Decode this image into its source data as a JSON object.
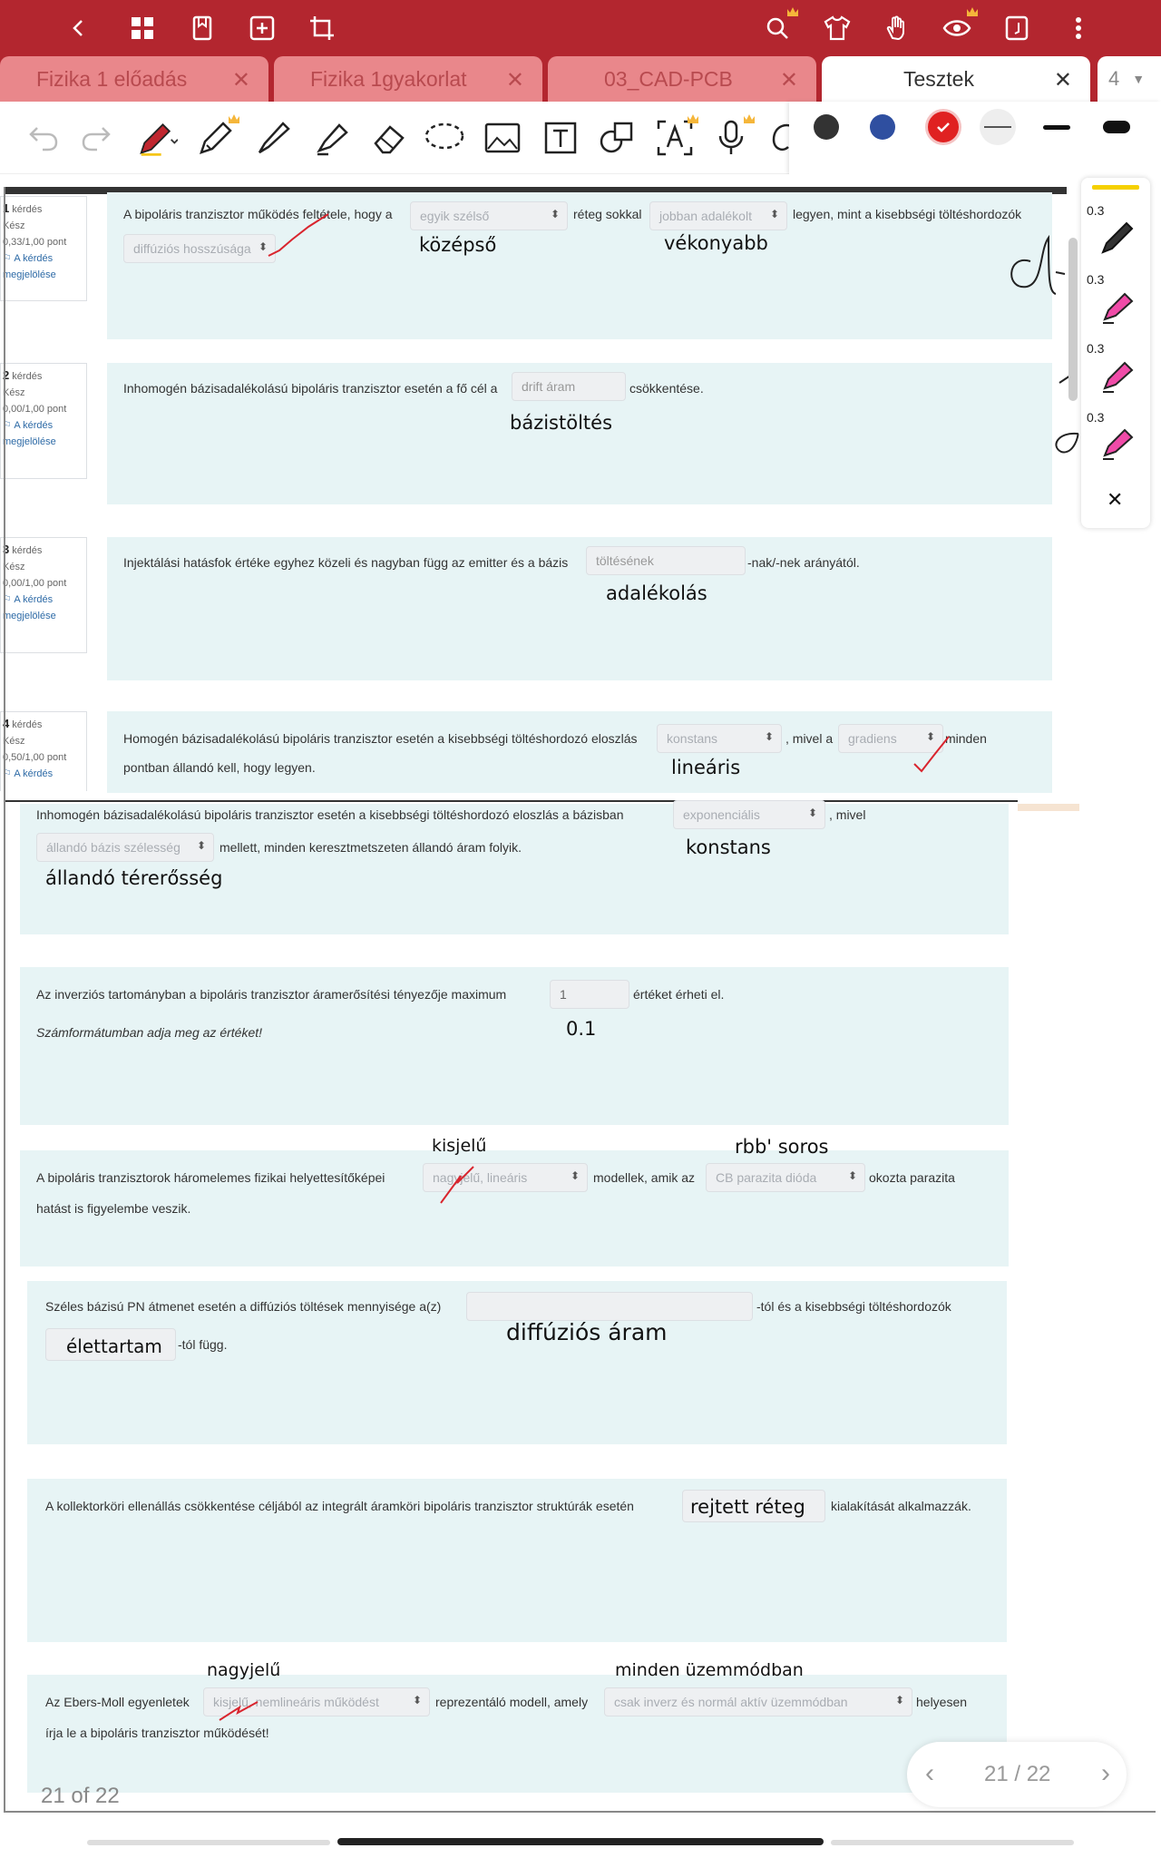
{
  "tabs": [
    {
      "label": "Fizika 1 előadás",
      "active": false
    },
    {
      "label": "Fizika 1gyakorlat",
      "active": false
    },
    {
      "label": "03_CAD-PCB",
      "active": false
    },
    {
      "label": "Tesztek",
      "active": true
    }
  ],
  "tab_count": "4",
  "colors": {
    "accent": "#b3262f",
    "swatch_black": "#333333",
    "swatch_blue": "#2f4fa0",
    "swatch_red": "#e02121"
  },
  "sidepanel": {
    "sizes": [
      "0.3",
      "0.3",
      "0.3",
      "0.3"
    ],
    "close": "✕"
  },
  "questions_info": [
    {
      "num": "1",
      "word": "kérdés",
      "status": "Kész",
      "points": "0,33/1,00 pont",
      "flag": "A kérdés",
      "flag2": "megjelölése"
    },
    {
      "num": "2",
      "word": "kérdés",
      "status": "Kész",
      "points": "0,00/1,00 pont",
      "flag": "A kérdés",
      "flag2": "megjelölése"
    },
    {
      "num": "3",
      "word": "kérdés",
      "status": "Kész",
      "points": "0,00/1,00 pont",
      "flag": "A kérdés",
      "flag2": "megjelölése"
    },
    {
      "num": "4",
      "word": "kérdés",
      "status": "Kész",
      "points": "0,50/1,00 pont",
      "flag": "A kérdés"
    }
  ],
  "q1": {
    "t1": "A bipoláris tranzisztor működés feltétele, hogy a",
    "s1": "egyik szélső",
    "t2": "réteg sokkal",
    "s2": "jobban adalékolt",
    "t3": "legyen, mint a kisebbségi töltéshordozók",
    "s3": "diffúziós hosszúsága",
    "hw1": "középső",
    "hw2": "vékonyabb"
  },
  "q2": {
    "t1": "Inhomogén bázisadalékolású bipoláris tranzisztor esetén a fő cél a",
    "s1": "drift áram",
    "t2": "csökkentése.",
    "hw1": "bázistöltés"
  },
  "q3": {
    "t1": "Injektálási hatásfok értéke egyhez közeli és nagyban függ az emitter és a bázis",
    "s1": "töltésének",
    "t2": "-nak/-nek arányától.",
    "hw1": "adalékolás"
  },
  "q4": {
    "t1": "Homogén bázisadalékolású bipoláris tranzisztor esetén a kisebbségi töltéshordozó eloszlás",
    "s1": "konstans",
    "t2": ", mivel a",
    "s2": "gradiens",
    "t3": "minden",
    "t4": "pontban állandó kell, hogy legyen.",
    "hw1": "lineáris"
  },
  "q5": {
    "t1": "Inhomogén bázisadalékolású bipoláris tranzisztor esetén a kisebbségi töltéshordozó eloszlás a bázisban",
    "s1": "exponenciális",
    "t2": ", mivel",
    "s2": "állandó bázis szélesség",
    "t3": "mellett, minden keresztmetszeten állandó áram folyik.",
    "hw1": "konstans",
    "hw2": "állandó térerősség"
  },
  "q6": {
    "t1": "Az inverziós tartományban a bipoláris tranzisztor áramerősítési tényezője maximum",
    "s1": "1",
    "t2": "értéket érheti el.",
    "t3": "Számformátumban adja meg az értéket!",
    "hw1": "0.1"
  },
  "q7": {
    "t1": "A bipoláris tranzisztorok háromelemes fizikai helyettesítőképei",
    "s1": "nagyjelű, lineáris",
    "t2": "modellek, amik az",
    "s2": "CB parazita dióda",
    "t3": "okozta parazita",
    "t4": "hatást is figyelembe veszik.",
    "hw1": "kisjelű",
    "hw2": "rbb' soros"
  },
  "q8": {
    "t1": "Széles bázisú PN átmenet esetén a diffúziós töltések mennyisége a(z)",
    "t2": "-tól és a kisebbségi töltéshordozók",
    "s2": "élettartam",
    "t3": "-tól függ.",
    "hw1": "diffúziós áram"
  },
  "q9": {
    "t1": "A kollektorköri ellenállás csökkentése céljából az integrált áramköri bipoláris tranzisztor struktúrák esetén",
    "s1": "rejtett réteg",
    "t2": "kialakítását alkalmazzák."
  },
  "q10": {
    "t1": "Az Ebers-Moll egyenletek",
    "s1": "kisjelű, nemlineáris működést",
    "t2": "reprezentáló modell, amely",
    "s2": "csak inverz és normál aktív üzemmódban",
    "t3": "helyesen",
    "t4": "írja le a bipoláris tranzisztor működését!",
    "hw1": "nagyjelű",
    "hw2": "minden üzemmódban"
  },
  "page": {
    "label": "21 / 22",
    "footer": "21 of 22"
  }
}
